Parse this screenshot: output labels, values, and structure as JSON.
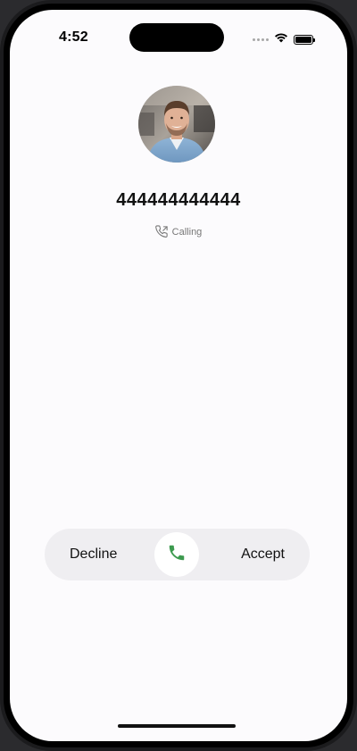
{
  "status_bar": {
    "time": "4:52",
    "icons": [
      "signal-dots-icon",
      "wifi-icon",
      "battery-icon"
    ]
  },
  "caller": {
    "avatar": "caller-photo",
    "number": "444444444444",
    "status_text": "Calling",
    "status_icon": "outgoing-call-icon"
  },
  "call_controls": {
    "decline_label": "Decline",
    "accept_label": "Accept",
    "knob_icon": "phone-icon",
    "accent_color": "#3d9a4f"
  }
}
